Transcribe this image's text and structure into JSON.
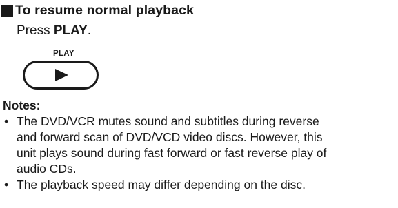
{
  "section": {
    "title": "To resume normal playback"
  },
  "instruction": {
    "prefix": "Press ",
    "button_name": "PLAY",
    "suffix": "."
  },
  "play_button": {
    "label": "PLAY",
    "icon": "play-triangle-icon"
  },
  "notes": {
    "title": "Notes:",
    "bullet": "•",
    "items": [
      {
        "lines": [
          "The DVD/VCR mutes sound and subtitles during reverse",
          "and forward scan of DVD/VCD video discs. However, this",
          "unit plays sound during fast forward or fast reverse play of",
          "audio CDs."
        ]
      },
      {
        "lines": [
          "The playback speed may differ depending on the disc."
        ]
      }
    ]
  }
}
